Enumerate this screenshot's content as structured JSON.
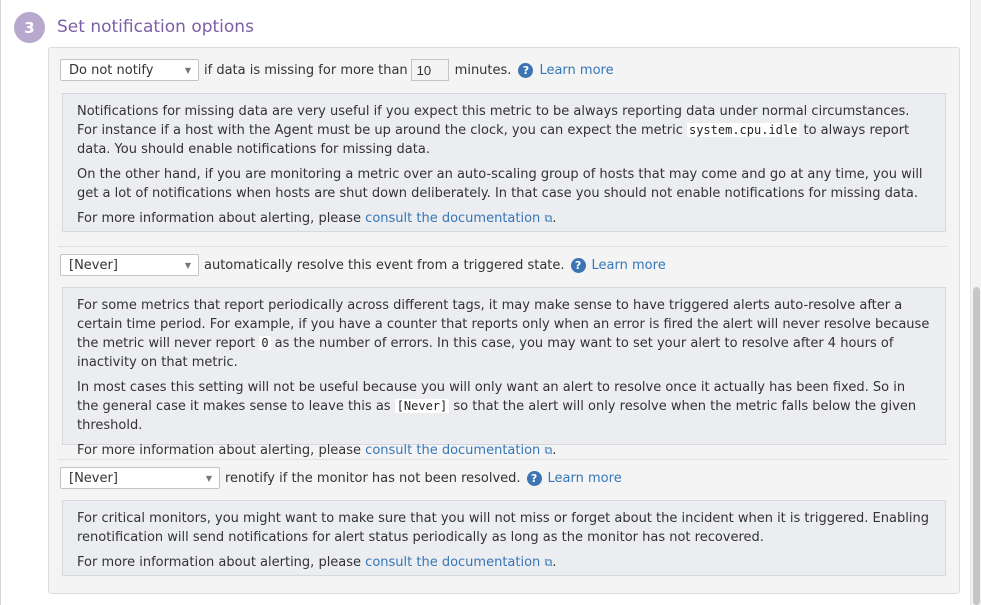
{
  "step": {
    "number": "3",
    "title": "Set notification options"
  },
  "missing_data": {
    "select_value": "Do not notify",
    "text_before": "if data is missing for more than",
    "minutes_value": "10",
    "text_after": "minutes.",
    "learn_more": "Learn more",
    "info": {
      "p1_a": "Notifications for missing data are very useful if you expect this metric to be always reporting data under normal circumstances. For instance if a host with the Agent must be up around the clock, you can expect the metric ",
      "p1_code": "system.cpu.idle",
      "p1_b": " to always report data. You should enable notifications for missing data.",
      "p2": "On the other hand, if you are monitoring a metric over an auto-scaling group of hosts that may come and go at any time, you will get a lot of notifications when hosts are shut down deliberately. In that case you should not enable notifications for missing data.",
      "more_prefix": "For more information about alerting, please ",
      "more_link": "consult the documentation",
      "more_suffix": "."
    }
  },
  "auto_resolve": {
    "select_value": "[Never]",
    "text": "automatically resolve this event from a triggered state.",
    "learn_more": "Learn more",
    "info": {
      "p1_a": "For some metrics that report periodically across different tags, it may make sense to have triggered alerts auto-resolve after a certain time period. For example, if you have a counter that reports only when an error is fired the alert will never resolve because the metric will never report ",
      "p1_code": "0",
      "p1_b": " as the number of errors. In this case, you may want to set your alert to resolve after 4 hours of inactivity on that metric.",
      "p2_a": "In most cases this setting will not be useful because you will only want an alert to resolve once it actually has been fixed. So in the general case it makes sense to leave this as ",
      "p2_code": "[Never]",
      "p2_b": " so that the alert will only resolve when the metric falls below the given threshold.",
      "more_prefix": "For more information about alerting, please ",
      "more_link": "consult the documentation",
      "more_suffix": "."
    }
  },
  "renotify": {
    "select_value": "[Never]",
    "text": "renotify if the monitor has not been resolved.",
    "learn_more": "Learn more",
    "info": {
      "p1": "For critical monitors, you might want to make sure that you will not miss or forget about the incident when it is triggered. Enabling renotification will send notifications for alert status periodically as long as the monitor has not recovered.",
      "more_prefix": "For more information about alerting, please ",
      "more_link": "consult the documentation",
      "more_suffix": "."
    }
  },
  "icons": {
    "help": "question-circle-icon",
    "external": "external-link-icon",
    "dropdown": "chevron-down-icon"
  },
  "colors": {
    "accent": "#7a5fa6",
    "badge": "#b7a8cd",
    "link": "#3577b8",
    "help_icon": "#3c74b4"
  }
}
